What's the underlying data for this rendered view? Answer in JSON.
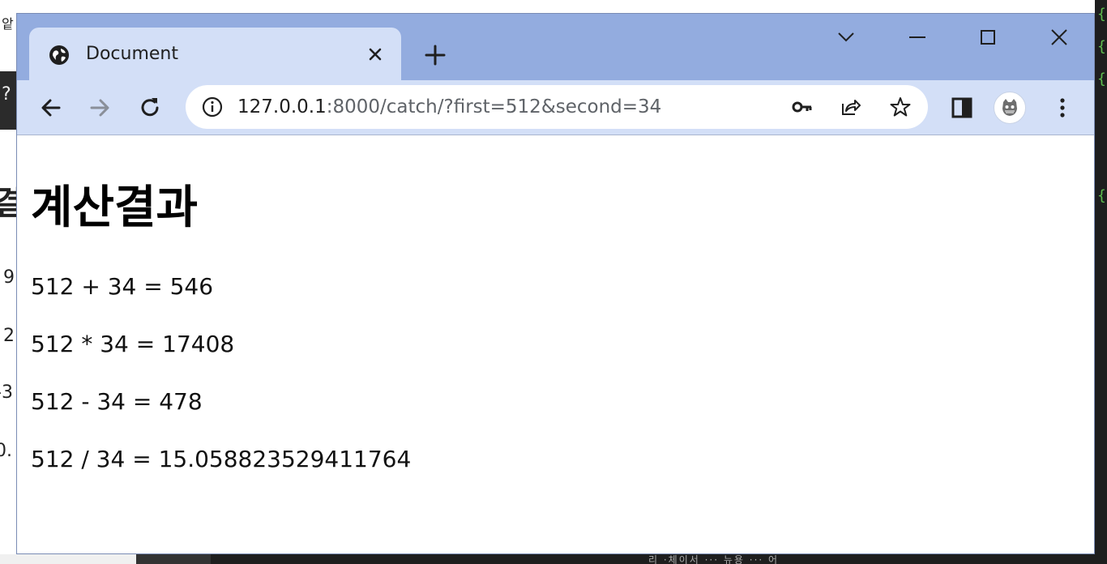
{
  "background": {
    "left_fragments": [
      "앝",
      "?",
      "결",
      "9",
      "2",
      "-3",
      "0."
    ],
    "right_braces": [
      "{",
      "{",
      "{",
      "{"
    ],
    "bottom_fragment": "리 ·체이서 ··· 뉴용 ··· 어"
  },
  "browser": {
    "tab": {
      "title": "Document",
      "favicon": "globe-icon",
      "close_icon": "close-icon"
    },
    "new_tab_icon": "plus-icon",
    "window_controls": {
      "tab_search": "chevron-down-icon",
      "minimize": "minimize-icon",
      "maximize": "maximize-icon",
      "close": "close-icon"
    },
    "toolbar": {
      "back_icon": "arrow-left-icon",
      "forward_icon": "arrow-right-icon",
      "reload_icon": "reload-icon",
      "url_host": "127.0.0.1",
      "url_rest": ":8000/catch/?first=512&second=34",
      "site_info_icon": "info-icon",
      "password_icon": "key-icon",
      "share_icon": "share-icon",
      "bookmark_icon": "star-icon",
      "side_panel_icon": "side-panel-icon",
      "profile_icon": "avatar",
      "menu_icon": "kebab-menu-icon"
    },
    "colors": {
      "titlebar": "#93acdf",
      "tab_and_toolbar": "#d3dff7",
      "omnibox": "#ffffff"
    }
  },
  "page": {
    "title": "계산결과",
    "results": [
      "512 + 34 = 546",
      "512 * 34 = 17408",
      "512 - 34 = 478",
      "512 / 34 = 15.058823529411764"
    ]
  }
}
